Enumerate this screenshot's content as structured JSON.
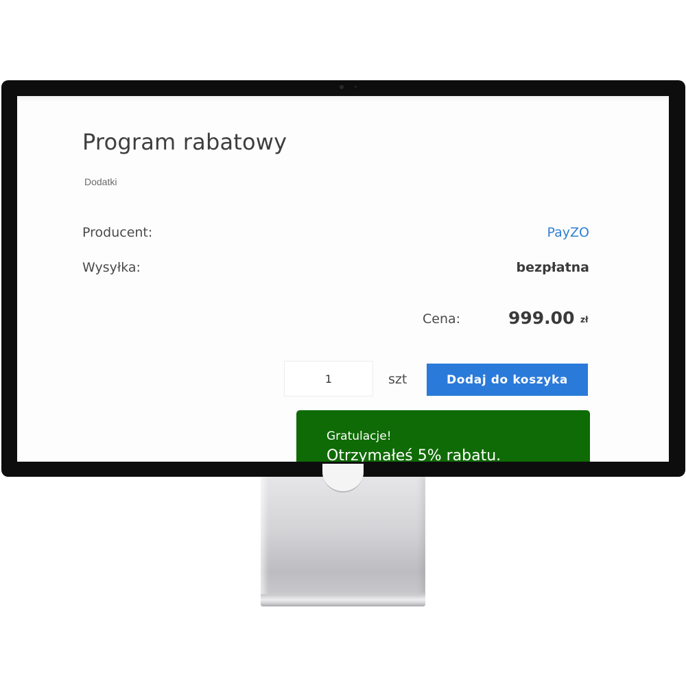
{
  "product": {
    "title": "Program rabatowy",
    "category": "Dodatki"
  },
  "details": {
    "producer_label": "Producent:",
    "producer_value": "PayZO",
    "shipping_label": "Wysyłka:",
    "shipping_value": "bezpłatna"
  },
  "price": {
    "label": "Cena:",
    "value": "999.00",
    "currency": "zł"
  },
  "cart": {
    "quantity": "1",
    "unit": "szt",
    "add_button_label": "Dodaj do koszyka"
  },
  "notice": {
    "title": "Gratulacje!",
    "text": "Otrzymałeś 5% rabatu."
  },
  "colors": {
    "link": "#2f7fd0",
    "button": "#2a7ad9",
    "notice_background": "#0f6b05"
  }
}
